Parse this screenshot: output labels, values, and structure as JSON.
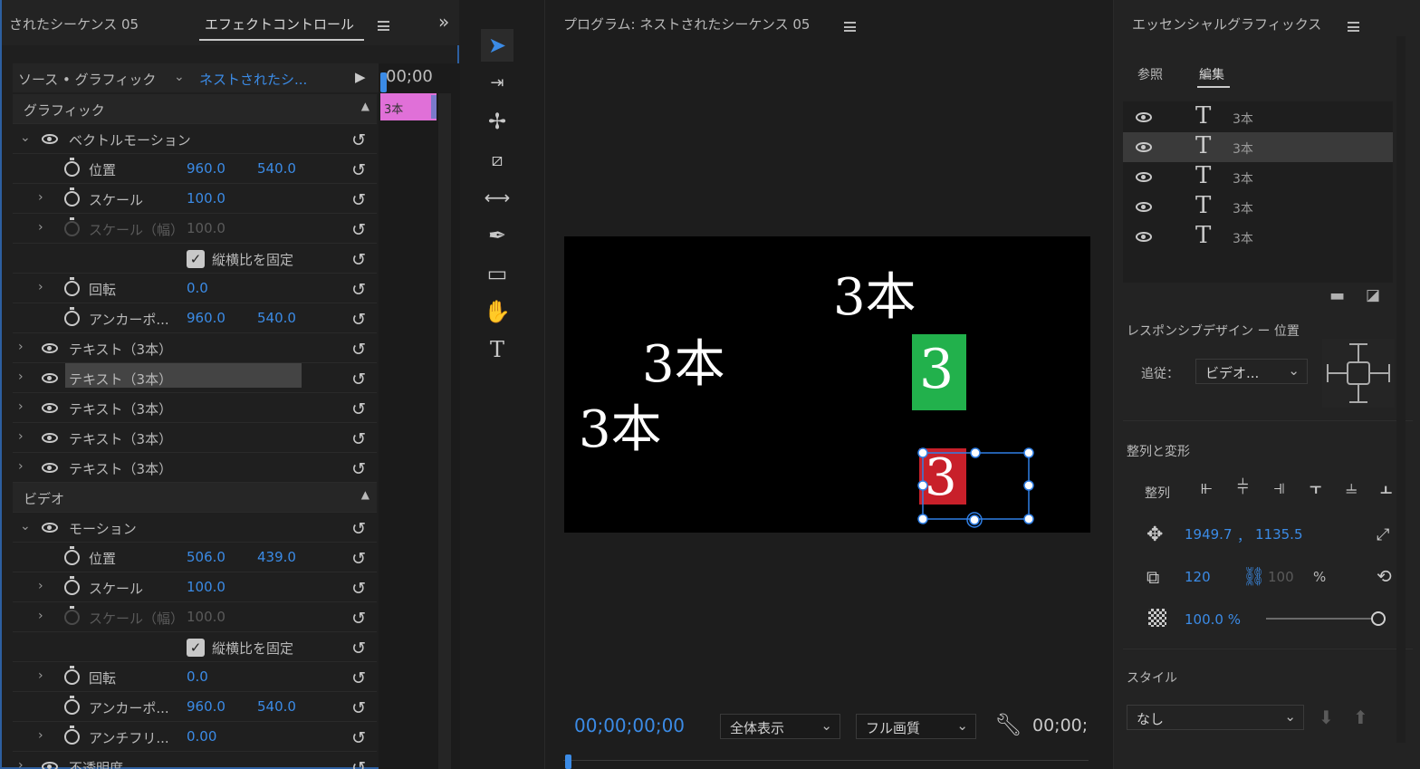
{
  "effect_controls": {
    "tab_left": "されたシーケンス 05",
    "tab_active": "エフェクトコントロール",
    "source_label": "ソース • グラフィック",
    "source_clip": "ネストされたシ...",
    "timecode": "00;00",
    "clip_label": "3本",
    "section_graphic": "グラフィック",
    "section_video": "ビデオ",
    "rows": [
      {
        "label": "ベクトルモーション"
      },
      {
        "label": "位置",
        "v1": "960.0",
        "v2": "540.0"
      },
      {
        "label": "スケール",
        "v1": "100.0"
      },
      {
        "label": "スケール（幅）",
        "v1": "100.0"
      },
      {
        "label": "縦横比を固定"
      },
      {
        "label": "回転",
        "v1": "0.0"
      },
      {
        "label": "アンカーポ...",
        "v1": "960.0",
        "v2": "540.0"
      },
      {
        "label": "テキスト（3本）"
      },
      {
        "label": "テキスト（3本）"
      },
      {
        "label": "テキスト（3本）"
      },
      {
        "label": "テキスト（3本）"
      },
      {
        "label": "テキスト（3本）"
      }
    ],
    "video_rows": [
      {
        "label": "モーション"
      },
      {
        "label": "位置",
        "v1": "506.0",
        "v2": "439.0"
      },
      {
        "label": "スケール",
        "v1": "100.0"
      },
      {
        "label": "スケール（幅）",
        "v1": "100.0"
      },
      {
        "label": "縦横比を固定"
      },
      {
        "label": "回転",
        "v1": "0.0"
      },
      {
        "label": "アンカーポ...",
        "v1": "960.0",
        "v2": "540.0"
      },
      {
        "label": "アンチフリ...",
        "v1": "0.00"
      },
      {
        "label": "不透明度"
      }
    ]
  },
  "program": {
    "title": "プログラム: ネストされたシーケンス 05",
    "canvas_texts": [
      "3本",
      "3本",
      "3本",
      "3",
      "3"
    ],
    "timecode": "00;00;00;00",
    "zoom": "全体表示",
    "quality": "フル画質",
    "timecode_right": "00;00;"
  },
  "essential_graphics": {
    "title": "エッセンシャルグラフィックス",
    "tab_browse": "参照",
    "tab_edit": "編集",
    "layers": [
      "3本",
      "3本",
      "3本",
      "3本",
      "3本"
    ],
    "responsive_title": "レスポンシブデザイン ー 位置",
    "follow_label": "追従：",
    "follow_value": "ビデオ...",
    "align_title": "整列と変形",
    "align_label": "整列",
    "pos_x": "1949.7",
    "pos_sep": "，",
    "pos_y": "1135.5",
    "scale": "120",
    "scale_w": "100",
    "scale_unit": "%",
    "opacity": "100.0 %",
    "style_title": "スタイル",
    "style_value": "なし"
  },
  "colors": {
    "accent": "#3b8be6",
    "green": "#22b14c",
    "red": "#c8202a",
    "clip": "#e070d8"
  }
}
